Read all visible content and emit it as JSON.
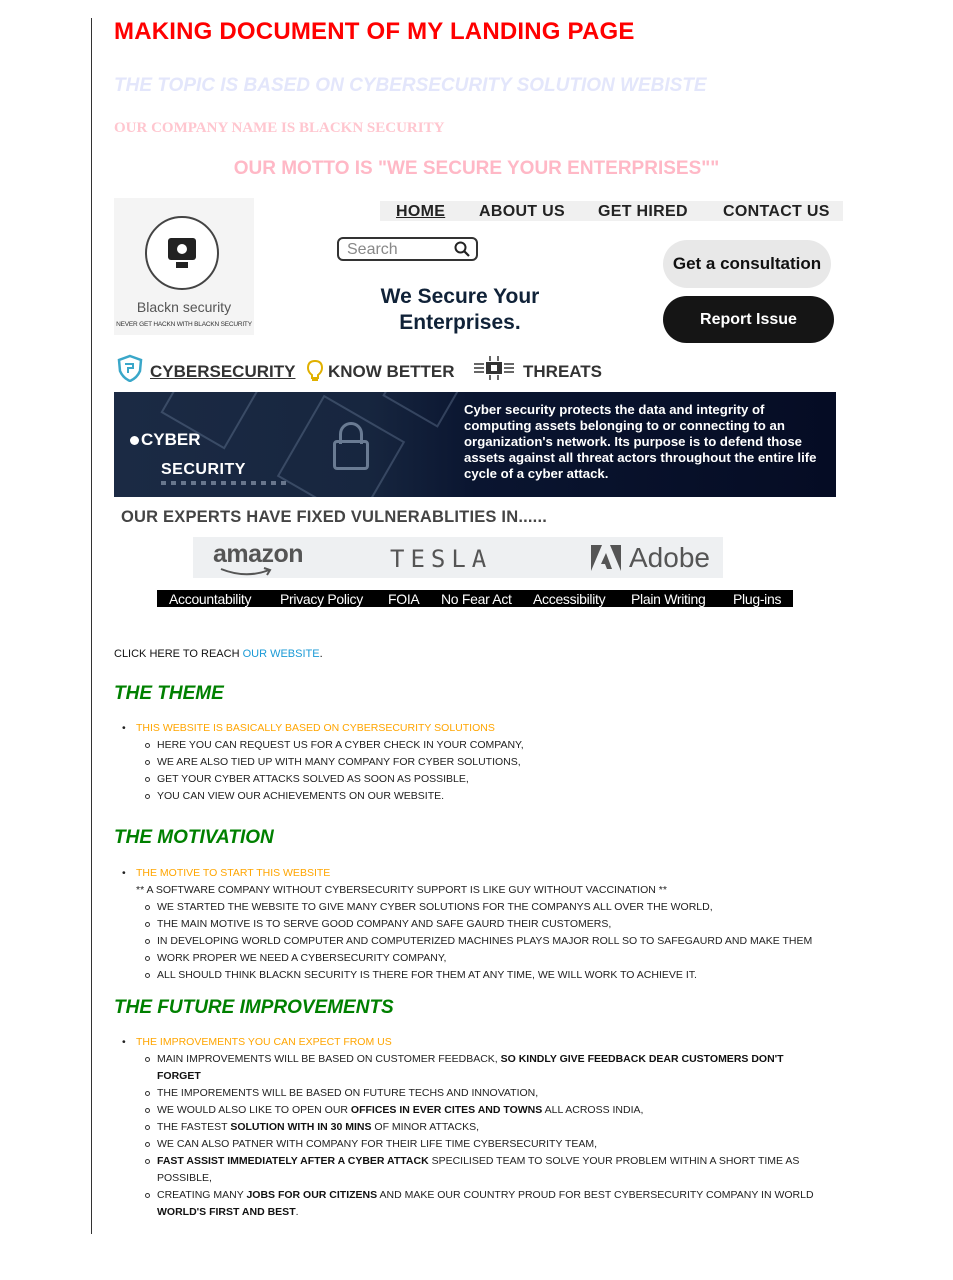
{
  "heading": {
    "title": "MAKING DOCUMENT OF MY LANDING PAGE",
    "topic": "THE TOPIC IS BASED ON CYBERSECURITY SOLUTION WEBISTE",
    "company": "OUR COMPANY NAME IS BLACKN SECURITY",
    "motto": "OUR MOTTO IS \"WE SECURE YOUR ENTERPRISES\"\""
  },
  "mockup": {
    "logo_name": "Blackn security",
    "logo_tagline": "NEVER GET HACKN WITH BLACKN SECURITY",
    "nav": [
      "HOME",
      "ABOUT US",
      "GET HIRED",
      "CONTACT US"
    ],
    "search_placeholder": "Search",
    "slogan_line1": "We Secure Your",
    "slogan_line2": "Enterprises.",
    "consult_button": "Get a consultation",
    "report_button": "Report Issue",
    "categories": [
      "CYBERSECURITY",
      "KNOW BETTER",
      "THREATS"
    ],
    "banner_word1": "CYBER",
    "banner_word2": "SECURITY",
    "banner_text": "Cyber security protects the data and integrity of computing assets belonging to or connecting to an organization's network. Its purpose is to defend those assets against all threat actors throughout the entire life cycle of a cyber attack.",
    "experts_heading": "OUR EXPERTS HAVE FIXED VULNERABLITIES IN......",
    "brands": [
      "amazon",
      "TESLA",
      "Adobe"
    ],
    "footer_links": [
      "Accountability",
      "Privacy Policy",
      "FOIA",
      "No Fear Act",
      "Accessibility",
      "Plain Writing",
      "Plug-ins"
    ]
  },
  "website_link": {
    "prefix": "CLICK HERE TO REACH ",
    "link_text": "OUR WEBSITE",
    "suffix": "."
  },
  "theme": {
    "heading": "THE THEME",
    "lead": "THIS WEBSITE IS BASICALLY BASED ON CYBERSECURITY SOLUTIONS",
    "items": [
      "HERE YOU CAN REQUEST US FOR A CYBER CHECK IN YOUR COMPANY,",
      "WE ARE ALSO TIED UP WITH MANY COMPANY FOR CYBER SOLUTIONS,",
      "GET YOUR CYBER ATTACKS SOLVED AS SOON AS POSSIBLE,",
      "YOU CAN VIEW OUR ACHIEVEMENTS ON OUR WEBSITE."
    ]
  },
  "motivation": {
    "heading": "THE MOTIVATION",
    "lead": "THE MOTIVE TO START THIS WEBSITE",
    "quote": "** A SOFTWARE COMPANY WITHOUT CYBERSECURITY SUPPORT IS LIKE GUY WITHOUT VACCINATION **",
    "items": [
      "WE STARTED THE WEBSITE TO GIVE MANY CYBER SOLUTIONS FOR THE COMPANYS ALL OVER THE WORLD,",
      "THE MAIN MOTIVE IS TO SERVE GOOD COMPANY AND SAFE GAURD THEIR CUSTOMERS,",
      "IN DEVELOPING WORLD COMPUTER AND COMPUTERIZED MACHINES PLAYS MAJOR ROLL SO TO SAFEGAURD AND MAKE THEM",
      "WORK PROPER WE NEED A CYBERSECURITY COMPANY,",
      "ALL SHOULD THINK BLACKN SECURITY IS THERE FOR THEM AT ANY TIME, WE WILL WORK TO ACHIEVE IT."
    ]
  },
  "future": {
    "heading": "THE FUTURE IMPROVEMENTS",
    "lead": "THE IMPROVEMENTS YOU CAN EXPECT FROM US",
    "i1a": "MAIN IMPROVEMENTS WILL BE BASED ON CUSTOMER FEEDBACK, ",
    "i1b": "SO KINDLY GIVE FEEDBACK DEAR CUSTOMERS DON'T",
    "i1c": "FORGET",
    "i2": "THE IMPOREMENTS WILL BE BASED ON FUTURE TECHS AND INNOVATION,",
    "i3a": "WE WOULD ALSO LIKE TO OPEN OUR ",
    "i3b": "OFFICES IN EVER CITES AND TOWNS",
    "i3c": " ALL ACROSS INDIA,",
    "i4a": "THE FASTEST ",
    "i4b": "SOLUTION WITH IN 30 MINS",
    "i4c": " OF MINOR ATTACKS,",
    "i5": "WE CAN ALSO PATNER WITH COMPANY FOR THEIR LIFE TIME CYBERSECURITY TEAM,",
    "i6a": "FAST ASSIST IMMEDIATELY AFTER A CYBER ATTACK",
    "i6b": " SPECILISED TEAM TO SOLVE YOUR PROBLEM WITHIN A SHORT TIME AS",
    "i6c": "POSSIBLE,",
    "i7a": "CREATING MANY ",
    "i7b": "JOBS FOR OUR CITIZENS",
    "i7c": " AND MAKE OUR COUNTRY PROUD FOR BEST CYBERSECURITY COMPANY IN WORLD",
    "i7d": "WORLD'S FIRST AND BEST",
    "i7e": "."
  }
}
